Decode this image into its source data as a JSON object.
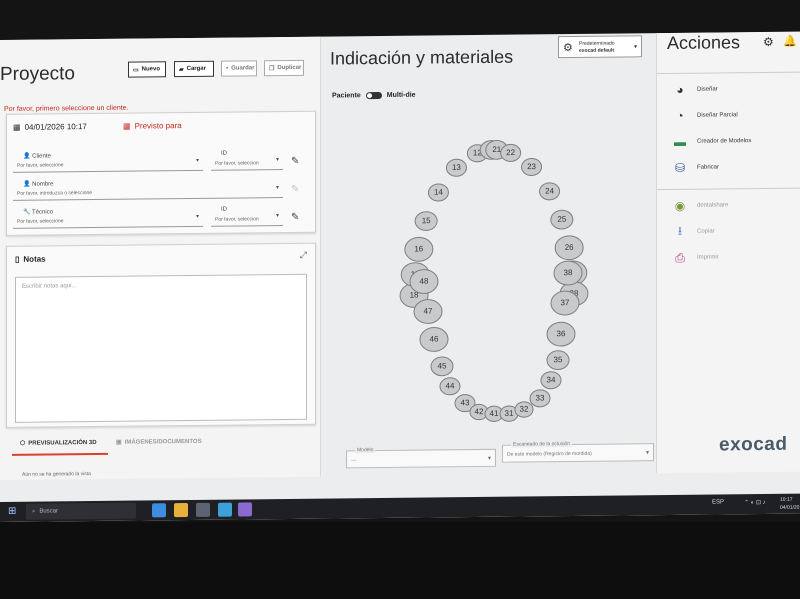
{
  "left": {
    "title": "Proyecto",
    "toolbar": {
      "new_label": "Nuevo",
      "load_label": "Cargar",
      "save_label": "Guardar",
      "duplicate_label": "Duplicar"
    },
    "warning": "Por favor, primero seleccione un cliente.",
    "date": "04/01/2026 10:17",
    "planned_label": "Previsto para",
    "fields": {
      "client": {
        "label": "Cliente",
        "value": "Por favor, seleccione"
      },
      "client_id": {
        "label": "ID",
        "value": "Por favor, seleccion"
      },
      "name": {
        "label": "Nombre",
        "value": "Por favor, introduzca o seleccione"
      },
      "technician": {
        "label": "Técnico",
        "value": "Por favor, seleccione"
      },
      "technician_id": {
        "label": "ID",
        "value": "Por favor, seleccion"
      }
    },
    "notes": {
      "title": "Notas",
      "placeholder": "Escribir notas aquí..."
    },
    "tabs": {
      "preview_3d": "PREVISUALIZACIÓN 3D",
      "images": "IMÁGENES/DOCUMENTOS"
    },
    "no_preview": "Aún no se ha generado la vista"
  },
  "center": {
    "title": "Indicación y materiales",
    "toggle": {
      "left": "Paciente",
      "right": "Multi-die"
    },
    "preset": {
      "line1": "Predeterminado",
      "line2": "exocad default"
    },
    "teeth_upper": [
      "18",
      "17",
      "16",
      "15",
      "14",
      "13",
      "12",
      "11",
      "21",
      "22",
      "23",
      "24",
      "25",
      "26",
      "27",
      "28"
    ],
    "teeth_lower": [
      "48",
      "47",
      "46",
      "45",
      "44",
      "43",
      "42",
      "41",
      "31",
      "32",
      "33",
      "34",
      "35",
      "36",
      "37",
      "38"
    ],
    "bottom": {
      "field1_label": "Modelo",
      "field1_value": "—",
      "field2_label": "Escaneado de la oclusión",
      "field2_value": "De este modelo (Registro de mordida)"
    }
  },
  "right": {
    "title": "Acciones",
    "actions": [
      {
        "label": "Diseñar",
        "icon": "design-icon"
      },
      {
        "label": "Diseñar Parcial",
        "icon": "partial-design-icon"
      },
      {
        "label": "Creador de Modelos",
        "icon": "model-creator-icon"
      },
      {
        "label": "Fabricar",
        "icon": "fabricate-icon"
      }
    ],
    "actions2": [
      {
        "label": "dentalshare",
        "icon": "share-icon"
      },
      {
        "label": "Copiar",
        "icon": "copy-icon"
      },
      {
        "label": "Imprimir",
        "icon": "print-icon"
      }
    ],
    "logo": "exocad"
  },
  "taskbar": {
    "search": "Buscar",
    "lang": "ESP",
    "time": "10:17",
    "date": "04/01/20"
  },
  "colors": {
    "accent_red": "#c0281e",
    "logo": "#4a5a6a",
    "tooth_fill": "#c9cacc"
  }
}
